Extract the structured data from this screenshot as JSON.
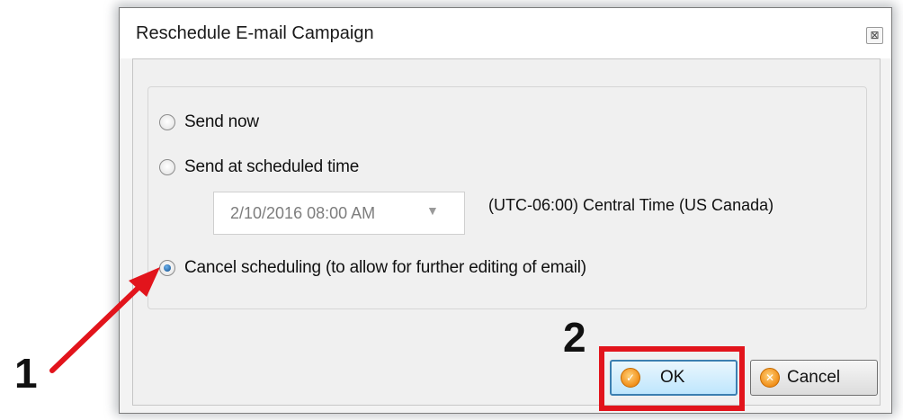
{
  "dialog": {
    "title": "Reschedule E-mail Campaign",
    "close_glyph": "⊠"
  },
  "options": [
    {
      "label": "Send now",
      "selected": false
    },
    {
      "label": "Send at scheduled time",
      "selected": false
    },
    {
      "label": "Cancel scheduling (to allow for further editing of email)",
      "selected": true
    }
  ],
  "scheduled": {
    "datetime_value": "2/10/2016 08:00 AM",
    "dropdown_glyph": "▼",
    "timezone": "(UTC-06:00) Central Time (US Canada)"
  },
  "buttons": {
    "ok_label": "OK",
    "cancel_label": "Cancel",
    "ok_icon": "check-icon",
    "cancel_icon": "x-icon"
  },
  "annotations": {
    "step1": "1",
    "step2": "2",
    "highlight_color": "#e2141c"
  }
}
